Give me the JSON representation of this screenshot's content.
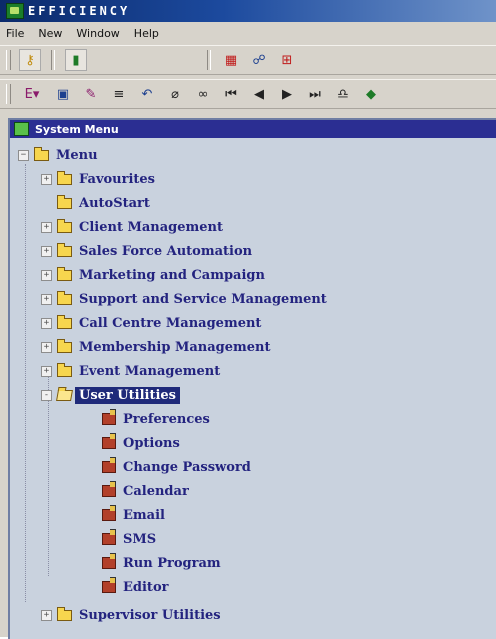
{
  "window": {
    "title": "EFFICIENCY"
  },
  "menubar": {
    "items": [
      "File",
      "New",
      "Window",
      "Help"
    ]
  },
  "panel": {
    "title": "System Menu",
    "root": {
      "label": "Menu"
    },
    "items": [
      {
        "label": "Favourites",
        "icon": "folder-icon",
        "expander": "+"
      },
      {
        "label": "AutoStart",
        "icon": "folder-icon",
        "expander": ""
      },
      {
        "label": "Client Management",
        "icon": "folder-icon",
        "expander": "+"
      },
      {
        "label": "Sales Force Automation",
        "icon": "folder-icon",
        "expander": "+"
      },
      {
        "label": "Marketing and Campaign",
        "icon": "folder-icon",
        "expander": "+"
      },
      {
        "label": "Support and Service Management",
        "icon": "folder-icon",
        "expander": "+"
      },
      {
        "label": "Call Centre Management",
        "icon": "folder-icon",
        "expander": "+"
      },
      {
        "label": "Membership Management",
        "icon": "folder-icon",
        "expander": "+"
      },
      {
        "label": "Event Management",
        "icon": "folder-icon",
        "expander": "+"
      },
      {
        "label": "User Utilities",
        "icon": "open-folder-icon",
        "expander": "-",
        "selected": true
      },
      {
        "label": "Supervisor Utilities",
        "icon": "folder-icon",
        "expander": "+"
      }
    ],
    "user_utilities_children": [
      "Preferences",
      "Options",
      "Change Password",
      "Calendar",
      "Email",
      "SMS",
      "Run Program",
      "Editor"
    ]
  },
  "colors": {
    "title_bar": "#1c4a9e",
    "panel_header": "#2b2e92",
    "tree_text": "#23237f",
    "tree_background": "#c9d2de",
    "selection": "#1f2a7a"
  }
}
